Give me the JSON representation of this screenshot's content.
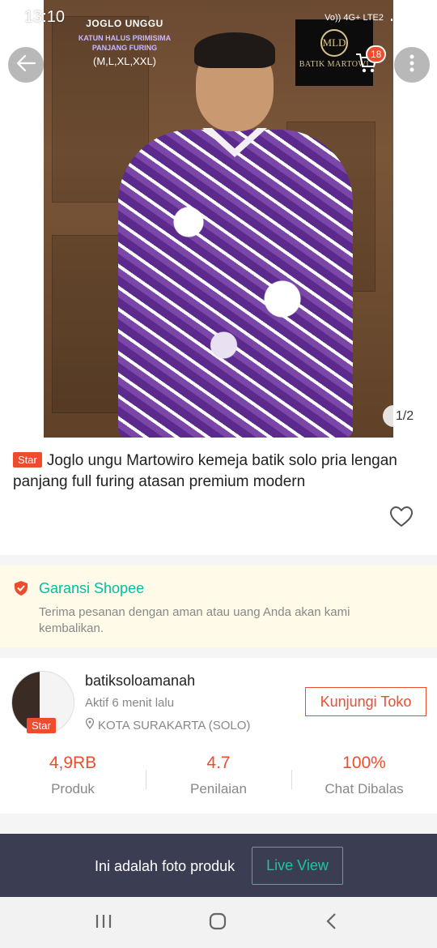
{
  "status_bar": {
    "time": "13:10",
    "network": "Vo)) 4G+ LTE2"
  },
  "product_image": {
    "overlay_line1": "JOGLO UNGGU",
    "overlay_line2": "KATUN HALUS PRIMISIMA",
    "overlay_line3": "PANJANG FURING",
    "overlay_line4": "(M,L,XL,XXL)",
    "brand_monogram": "MLD",
    "brand_name": "BATIK MARTOWI",
    "counter": "1/2"
  },
  "header": {
    "cart_count": "18"
  },
  "product": {
    "badge": "Star",
    "title": "Joglo ungu Martowiro kemeja batik solo pria lengan panjang full furing atasan premium modern"
  },
  "guarantee": {
    "title": "Garansi Shopee",
    "description": "Terima pesanan dengan aman atau uang Anda akan kami kembalikan."
  },
  "shop": {
    "name": "batiksoloamanah",
    "badge": "Star",
    "active": "Aktif 6 menit lalu",
    "location": "KOTA SURAKARTA (SOLO)",
    "visit_label": "Kunjungi Toko",
    "stats": [
      {
        "value": "4,9RB",
        "label": "Produk"
      },
      {
        "value": "4.7",
        "label": "Penilaian"
      },
      {
        "value": "100%",
        "label": "Chat Dibalas"
      }
    ]
  },
  "live_banner": {
    "text": "Ini adalah foto produk",
    "button": "Live View"
  },
  "colors": {
    "accent": "#ee4d2d",
    "teal": "#00bfa5",
    "live_bar": "#3b3e52"
  }
}
